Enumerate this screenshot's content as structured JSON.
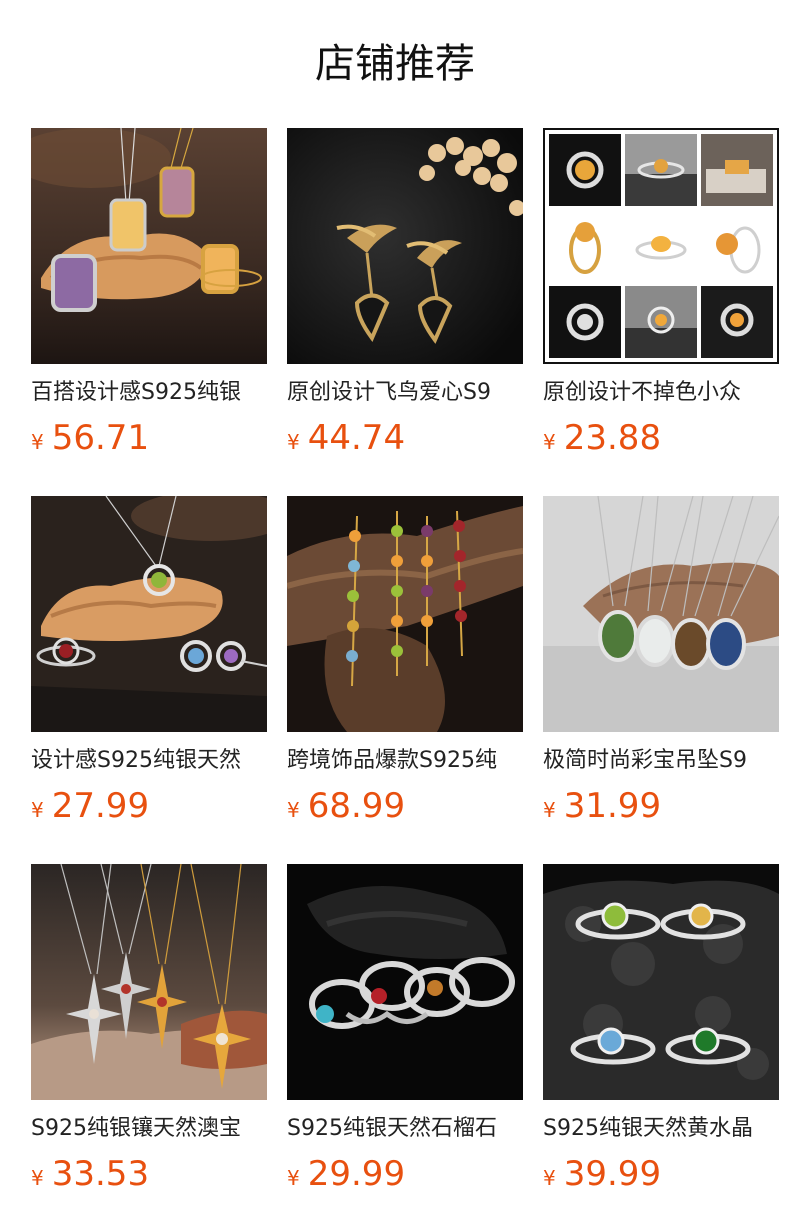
{
  "header": {
    "title": "店铺推荐"
  },
  "currency": "¥",
  "products": [
    {
      "name": "百搭设计感S925纯银",
      "price": "56.71",
      "image": "necklaces-with-purple-and-citrine-gems-on-rock"
    },
    {
      "name": "原创设计飞鸟爱心S9",
      "price": "44.74",
      "image": "gold-swallow-heart-earrings"
    },
    {
      "name": "原创设计不掉色小众",
      "price": "23.88",
      "image": "citrine-ring-collage"
    },
    {
      "name": "设计感S925纯银天然",
      "price": "27.99",
      "image": "peridot-pendant-and-gem-rings-on-rock"
    },
    {
      "name": "跨境饰品爆款S925纯",
      "price": "68.99",
      "image": "gemstone-bracelets-on-driftwood"
    },
    {
      "name": "极简时尚彩宝吊坠S9",
      "price": "31.99",
      "image": "oval-stone-pendants-on-wood"
    },
    {
      "name": "S925纯银镶天然澳宝",
      "price": "33.53",
      "image": "star-cross-pendants"
    },
    {
      "name": "S925纯银天然石榴石",
      "price": "29.99",
      "image": "knot-rings-on-black"
    },
    {
      "name": "S925纯银天然黄水晶",
      "price": "39.99",
      "image": "gem-rings-on-lava-rock"
    }
  ]
}
